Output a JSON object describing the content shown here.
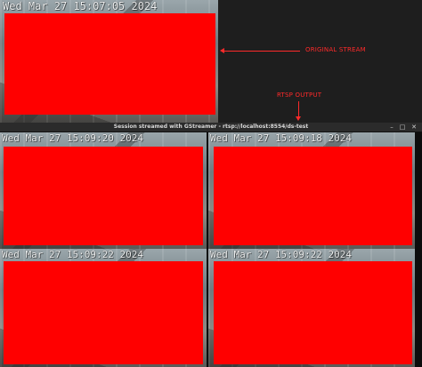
{
  "original_stream": {
    "timestamp": "Wed Mar 27 15:07:05 2024",
    "annotation": "ORIGINAL STREAM"
  },
  "rtsp_annotation": "RTSP OUTPUT",
  "player_window": {
    "title": "Session streamed with GStreamer - rtsp://localhost:8554/ds-test",
    "controls": {
      "minimize": "–",
      "maximize": "□",
      "close": "✕"
    },
    "tiles": [
      {
        "timestamp": "Wed Mar 27 15:09:20 2024"
      },
      {
        "timestamp": "Wed Mar 27 15:09:18 2024"
      },
      {
        "timestamp": "Wed Mar 27 15:09:22 2024"
      },
      {
        "timestamp": "Wed Mar 27 15:09:22 2024"
      }
    ]
  },
  "colors": {
    "overlay_red": "#ff0000",
    "annotation_red": "#ff2a2a",
    "background": "#1e1e1e"
  }
}
